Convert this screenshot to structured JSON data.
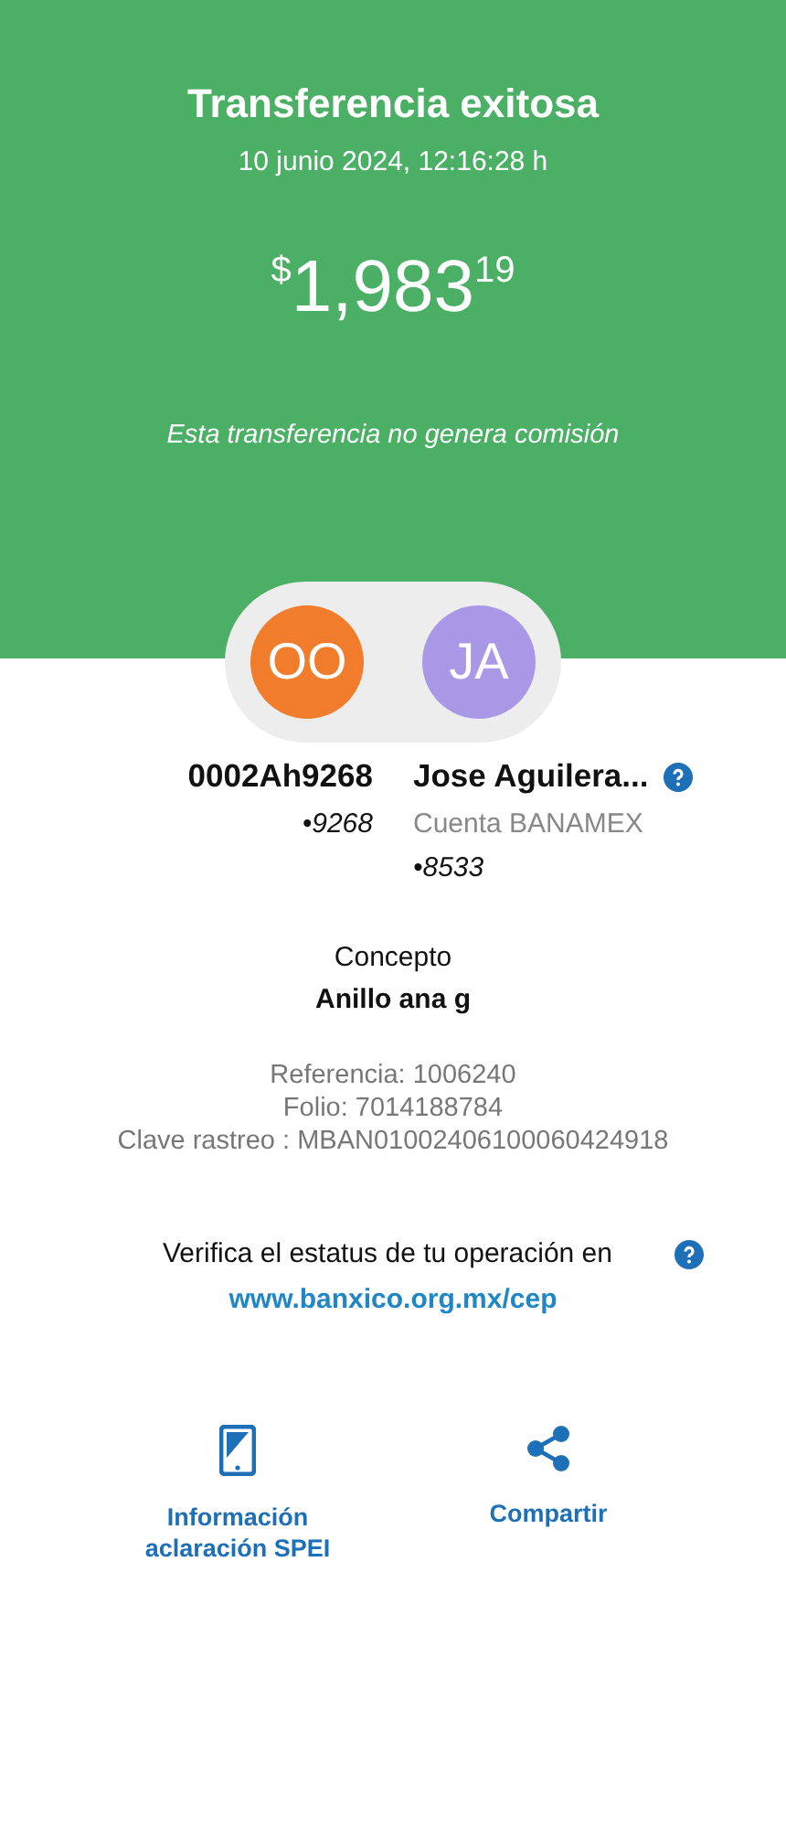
{
  "header": {
    "title": "Transferencia exitosa",
    "date": "10 junio 2024, 12:16:28 h",
    "amount": {
      "currency": "$",
      "whole": "1,983",
      "cents": "19"
    },
    "note": "Esta transferencia no genera comisión"
  },
  "parties": [
    {
      "initials": "OO",
      "color": "#f07c2c",
      "name": "0002Ah9268",
      "account": "•9268",
      "help": false
    },
    {
      "initials": "JA",
      "color": "#a898e6",
      "name": "Jose Aguilera...",
      "bank": "Cuenta BANAMEX",
      "account": "•8533",
      "help": true
    }
  ],
  "concept": {
    "label": "Concepto",
    "value": "Anillo ana g"
  },
  "details": [
    "Referencia: 1006240",
    "Folio: 7014188784",
    "Clave rastreo : MBAN01002406100060424918"
  ],
  "verify": {
    "text": "Verifica el estatus de tu operación en",
    "link": "www.banxico.org.mx/cep"
  },
  "actions": [
    {
      "kind": "phone",
      "label": "Información aclaración SPEI"
    },
    {
      "kind": "share",
      "label": "Compartir"
    }
  ]
}
